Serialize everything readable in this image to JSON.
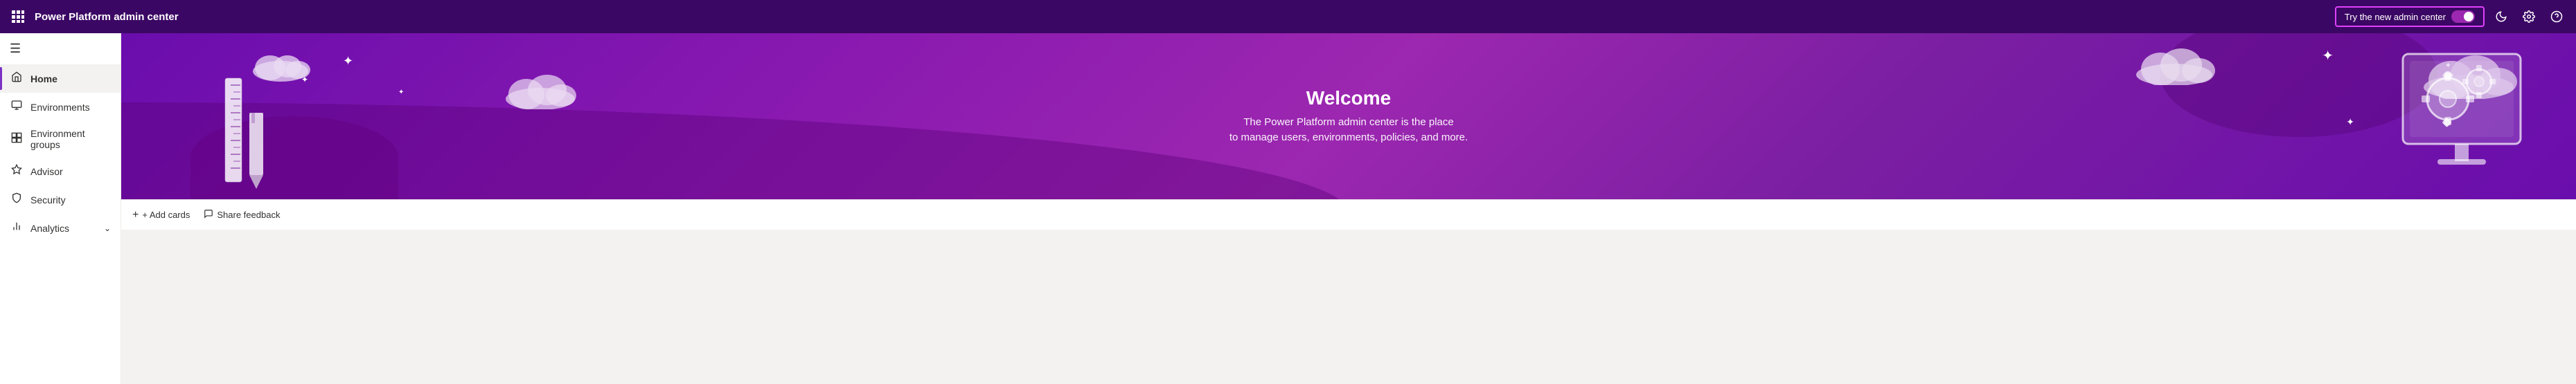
{
  "topNav": {
    "appTitle": "Power Platform admin center",
    "tryNewAdmin": "Try the new admin center",
    "accentColor": "#e040fb",
    "borderColor": "#e040fb"
  },
  "sidebar": {
    "items": [
      {
        "label": "Home",
        "icon": "⌂",
        "active": true
      },
      {
        "label": "Environments",
        "icon": "🌐",
        "active": false
      },
      {
        "label": "Environment groups",
        "icon": "⊞",
        "active": false
      },
      {
        "label": "Advisor",
        "icon": "◈",
        "active": false
      },
      {
        "label": "Security",
        "icon": "🔒",
        "active": false
      },
      {
        "label": "Analytics",
        "icon": "📊",
        "active": false,
        "hasChevron": true
      }
    ]
  },
  "banner": {
    "title": "Welcome",
    "subtitle1": "The Power Platform admin center is the place",
    "subtitle2": "to manage users, environments, policies, and more."
  },
  "toolbar": {
    "addCards": "+ Add cards",
    "shareFeedback": "Share feedback"
  }
}
